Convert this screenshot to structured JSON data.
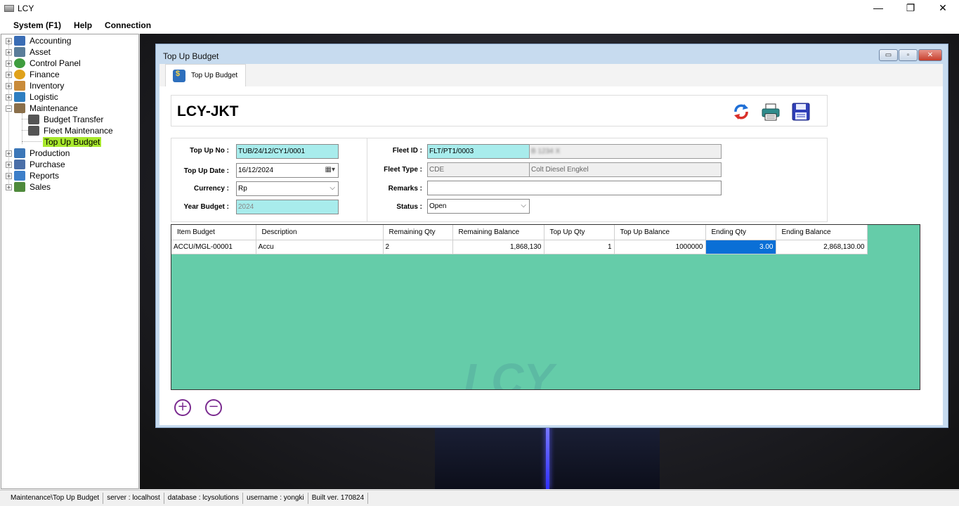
{
  "app": {
    "title": "LCY"
  },
  "window_controls": {
    "minimize": "—",
    "restore": "❐",
    "close": "✕"
  },
  "menu": [
    "System (F1)",
    "Help",
    "Connection"
  ],
  "tree": {
    "items": [
      {
        "label": "Accounting",
        "expander": "+",
        "icon_color": "#3a6db5"
      },
      {
        "label": "Asset",
        "expander": "+",
        "icon_color": "#5a7d9a"
      },
      {
        "label": "Control Panel",
        "expander": "+",
        "icon_color": "#3f9d3f"
      },
      {
        "label": "Finance",
        "expander": "+",
        "icon_color": "#e0a21b"
      },
      {
        "label": "Inventory",
        "expander": "+",
        "icon_color": "#c98b3a"
      },
      {
        "label": "Logistic",
        "expander": "+",
        "icon_color": "#2f7fc1"
      },
      {
        "label": "Maintenance",
        "expander": "−",
        "icon_color": "#8a6f4a"
      },
      {
        "label": "Budget Transfer",
        "icon_color": "#555"
      },
      {
        "label": "Fleet Maintenance",
        "icon_color": "#555"
      },
      {
        "label": "Top Up Budget",
        "selected": true
      },
      {
        "label": "Production",
        "expander": "+",
        "icon_color": "#3c77b8"
      },
      {
        "label": "Purchase",
        "expander": "+",
        "icon_color": "#4b6fa8"
      },
      {
        "label": "Reports",
        "expander": "+",
        "icon_color": "#3d7fc9"
      },
      {
        "label": "Sales",
        "expander": "+",
        "icon_color": "#4f8a3c"
      }
    ]
  },
  "child_window": {
    "title": "Top Up Budget",
    "tab_label": "Top Up Budget",
    "controls": {
      "minimize": "▭",
      "restore": "▫",
      "close": "✕"
    }
  },
  "header": {
    "company": "LCY-JKT",
    "tools": [
      "refresh-icon",
      "print-icon",
      "save-icon"
    ]
  },
  "form": {
    "top_up_no_label": "Top Up No :",
    "top_up_no": "TUB/24/12/CY1/0001",
    "top_up_date_label": "Top Up Date :",
    "top_up_date": "16/12/2024",
    "currency_label": "Currency :",
    "currency": "Rp",
    "year_budget_label": "Year Budget :",
    "year_budget": "2024",
    "fleet_id_label": "Fleet ID :",
    "fleet_id": "FLT/PT1/0003",
    "fleet_id_desc": "B 1234 X",
    "fleet_type_label": "Fleet Type :",
    "fleet_type": "CDE",
    "fleet_type_desc": "Colt Diesel Engkel",
    "remarks_label": "Remarks :",
    "remarks": "",
    "status_label": "Status :",
    "status": "Open"
  },
  "grid": {
    "columns": [
      "Item Budget",
      "Description",
      "Remaining Qty",
      "Remaining Balance",
      "Top Up Qty",
      "Top Up Balance",
      "Ending Qty",
      "Ending Balance"
    ],
    "rows": [
      [
        "ACCU/MGL-00001",
        "Accu",
        "2",
        "1,868,130",
        "1",
        "1000000",
        "3.00",
        "2,868,130.00"
      ]
    ]
  },
  "buttons": {
    "add": "+",
    "remove": "−"
  },
  "watermark": "LCY",
  "statusbar": [
    "Maintenance\\Top Up Budget",
    "server : localhost",
    "database : lcysolutions",
    "username : yongki",
    "Built ver. 170824"
  ]
}
